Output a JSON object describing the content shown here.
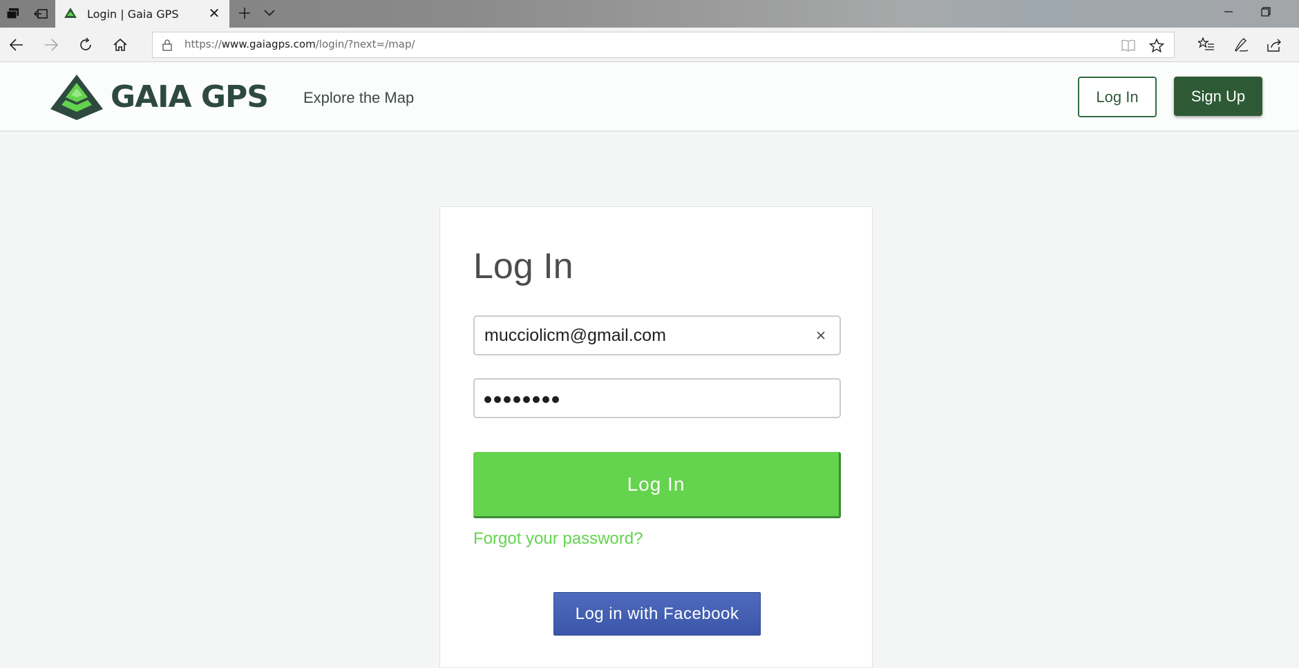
{
  "browser": {
    "tab_title": "Login | Gaia GPS",
    "url_prefix": "https://",
    "url_domain": "www.gaiagps.com",
    "url_path": "/login/?next=/map/"
  },
  "header": {
    "brand": "GAIA GPS",
    "explore_link": "Explore the Map",
    "login_button": "Log In",
    "signup_button": "Sign Up"
  },
  "login": {
    "title": "Log In",
    "email_value": "mucciolicm@gmail.com",
    "password_length": 8,
    "submit_button": "Log In",
    "forgot_link": "Forgot your password?",
    "facebook_button": "Log in with Facebook"
  },
  "colors": {
    "brand_dark_green": "#2e4a3e",
    "signup_green": "#2d5a35",
    "login_green": "#64d34d",
    "facebook_blue": "#3b56a9"
  }
}
